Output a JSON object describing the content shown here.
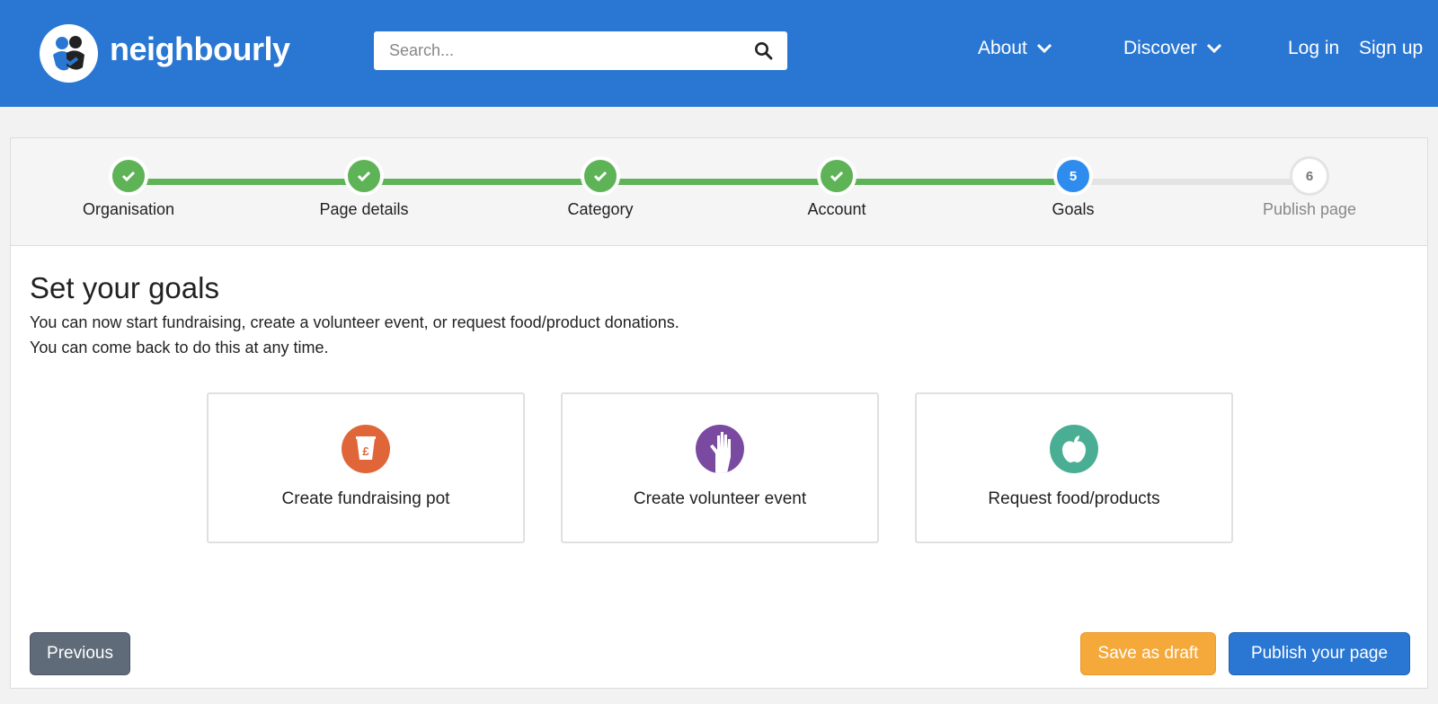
{
  "brand": {
    "name": "neighbourly",
    "logo_icon": "neighbourly-logo-icon"
  },
  "search": {
    "placeholder": "Search...",
    "icon": "search-icon"
  },
  "nav": {
    "about": "About",
    "discover": "Discover",
    "login": "Log in",
    "signup": "Sign up"
  },
  "steps": [
    {
      "label": "Organisation",
      "state": "done",
      "number": ""
    },
    {
      "label": "Page details",
      "state": "done",
      "number": ""
    },
    {
      "label": "Category",
      "state": "done",
      "number": ""
    },
    {
      "label": "Account",
      "state": "done",
      "number": ""
    },
    {
      "label": "Goals",
      "state": "current",
      "number": "5"
    },
    {
      "label": "Publish page",
      "state": "todo",
      "number": "6"
    }
  ],
  "main": {
    "title": "Set your goals",
    "desc_line1": "You can now start fundraising, create a volunteer event, or request food/product donations.",
    "desc_line2": "You can come back to do this at any time."
  },
  "goals": [
    {
      "label": "Create fundraising pot",
      "icon": "fundraising-pot-icon",
      "color": "#e0663a"
    },
    {
      "label": "Create volunteer event",
      "icon": "volunteer-hand-icon",
      "color": "#7a4aa0"
    },
    {
      "label": "Request food/products",
      "icon": "apple-icon",
      "color": "#4aae94"
    }
  ],
  "buttons": {
    "previous": "Previous",
    "save_draft": "Save as draft",
    "publish": "Publish your page"
  },
  "colors": {
    "header": "#2a77d3",
    "step_done": "#5fb357",
    "step_current": "#2f8cef",
    "draft": "#f4a93a",
    "publish": "#2a77d3",
    "previous": "#5f6b79"
  }
}
